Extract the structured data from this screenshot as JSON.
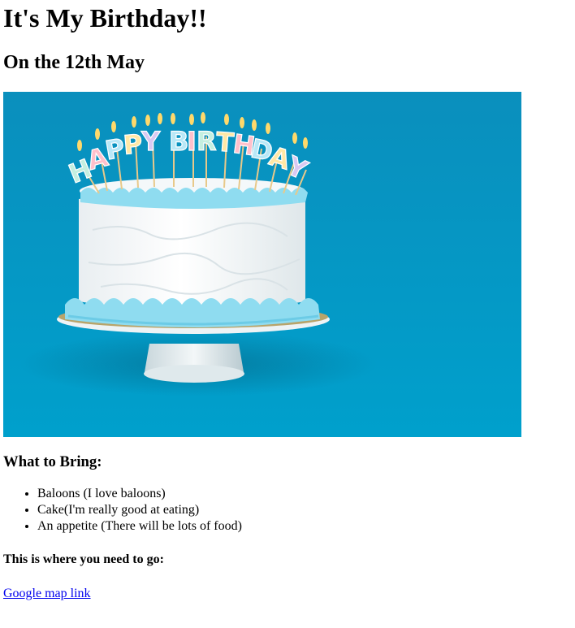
{
  "heading": "It's My Birthday!!",
  "subheading": "On the 12th May",
  "image": {
    "subject": "birthday-cake",
    "candle_text": "HAPPY BIRTHDAY",
    "colors": {
      "background": "#0796c4",
      "frosting_blue": "#8fdcf0",
      "cake_white": "#f6f9fb",
      "plate": "#e7eef1"
    }
  },
  "bring_title": "What to Bring:",
  "bring_items": [
    "Baloons (I love baloons)",
    "Cake(I'm really good at eating)",
    "An appetite (There will be lots of food)"
  ],
  "location_title": "This is where you need to go:",
  "map_link": {
    "label": "Google map link",
    "color": "#0000ee"
  }
}
